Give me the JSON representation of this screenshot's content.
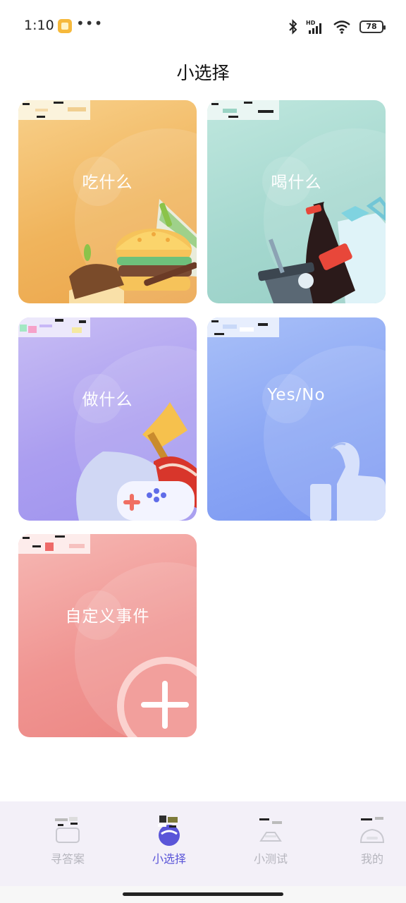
{
  "status_bar": {
    "time": "1:10",
    "dots": "•••",
    "battery": "78",
    "network_label": "HD"
  },
  "page_title": "小选择",
  "cards": [
    {
      "id": "eat",
      "label": "吃什么",
      "illustration": "burger-sandwich-cake-icon"
    },
    {
      "id": "drink",
      "label": "喝什么",
      "illustration": "soda-cola-drinks-icon"
    },
    {
      "id": "do",
      "label": "做什么",
      "illustration": "pillow-gamepad-shoe-broom-icon"
    },
    {
      "id": "yesno",
      "label": "Yes/No",
      "illustration": "thumbs-up-icon"
    },
    {
      "id": "custom",
      "label": "自定义事件",
      "illustration": "plus-icon"
    }
  ],
  "nav": {
    "answers": "寻答案",
    "choose": "小选择",
    "quiz": "小测试",
    "mine": "我的",
    "active": "choose"
  },
  "colors": {
    "accent": "#5a55d8",
    "inactive": "#b5b5bd",
    "eat": "#f0b45c",
    "drink": "#a5d8cf",
    "do": "#ab9ef0",
    "yesno": "#8aa6f4",
    "custom": "#f09592"
  }
}
